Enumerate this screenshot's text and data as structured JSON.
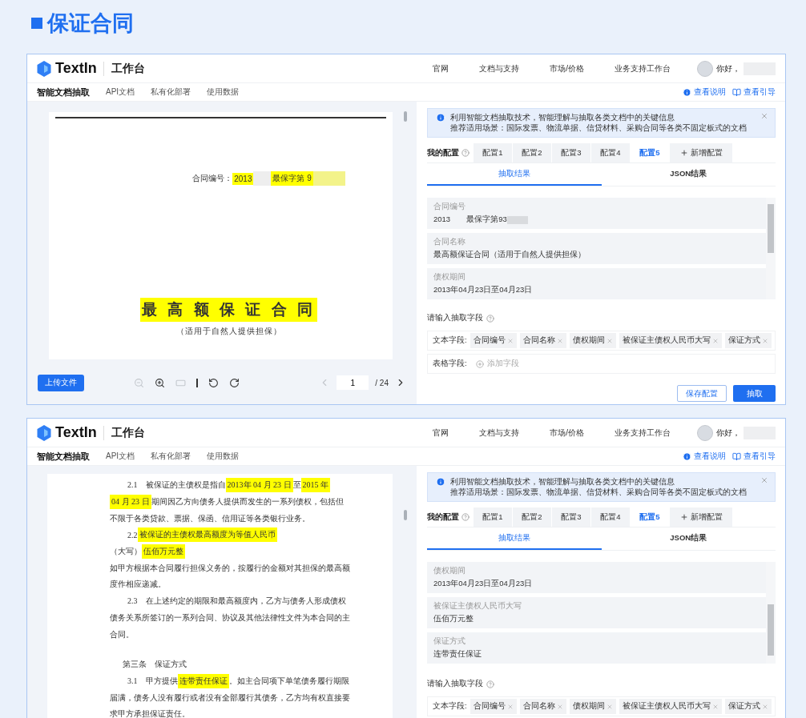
{
  "heading": "保证合同",
  "panels": [
    {
      "brand": "TextIn",
      "workspace": "工作台",
      "nav": [
        "官网",
        "文档与支持",
        "市场/价格",
        "业务支持工作台"
      ],
      "greeting": "你好，",
      "name_redacted": true,
      "tabs": [
        {
          "label": "智能文档抽取",
          "selected": true
        },
        {
          "label": "API文档",
          "selected": false
        },
        {
          "label": "私有化部署",
          "selected": false
        },
        {
          "label": "使用数据",
          "selected": false
        }
      ],
      "help_links": [
        {
          "kind": "info",
          "label": "查看说明"
        },
        {
          "kind": "guide",
          "label": "查看引导"
        }
      ],
      "document": {
        "kind": "cover",
        "lines": [
          {
            "kind": "meta",
            "segments": [
              {
                "kind": "text",
                "text": "合同编号：",
                "highlight": false
              },
              {
                "kind": "text",
                "text": "2013",
                "highlight": true
              },
              {
                "kind": "redaction",
                "highlight": false
              },
              {
                "kind": "text",
                "text": "最保字第 9",
                "highlight": true
              },
              {
                "kind": "redaction",
                "highlight": true
              }
            ]
          },
          {
            "kind": "title",
            "segments": [
              {
                "kind": "text",
                "text": "最 高 额 保 证 合 同",
                "highlight": true
              }
            ]
          },
          {
            "kind": "subtitle",
            "segments": [
              {
                "kind": "text",
                "text": "（适用于自然人提供担保）",
                "highlight": false
              }
            ]
          }
        ]
      },
      "toolbar": {
        "upload": "上传文件",
        "tools": [
          {
            "kind": "zoom-out",
            "disabled": true
          },
          {
            "kind": "zoom-in",
            "disabled": false
          },
          {
            "kind": "fit",
            "disabled": true
          },
          {
            "kind": "rotate-left",
            "disabled": false
          },
          {
            "kind": "rotate-right",
            "disabled": false
          }
        ],
        "prev_disabled": true,
        "page": "1",
        "total": "/ 24"
      },
      "banner": [
        "利用智能文档抽取技术，智能理解与抽取各类文档中的关键信息",
        "推荐适用场景：国际发票、物流单据、信贷材料、采购合同等各类不固定板式的文档"
      ],
      "config_label": "我的配置",
      "configs": [
        {
          "label": "配置1",
          "selected": false
        },
        {
          "label": "配置2",
          "selected": false
        },
        {
          "label": "配置3",
          "selected": false
        },
        {
          "label": "配置4",
          "selected": false
        },
        {
          "label": "配置5",
          "selected": true
        }
      ],
      "add_config": "新增配置",
      "result_tabs": [
        {
          "label": "抽取结果",
          "selected": true
        },
        {
          "label": "JSON结果",
          "selected": false
        }
      ],
      "results": [
        {
          "label": "合同编号",
          "value": "2013　　最保字第93",
          "redacted": true
        },
        {
          "label": "合同名称",
          "value": "最高额保证合同（适用于自然人提供担保）",
          "redacted": false
        },
        {
          "label": "债权期间",
          "value": "2013年04月23日至04月23日",
          "redacted": false
        }
      ],
      "field_prompt": "请输入抽取字段",
      "text_fields": {
        "label": "文本字段:",
        "tags": [
          "合同编号",
          "合同名称",
          "债权期间",
          "被保证主债权人民币大写",
          "保证方式"
        ]
      },
      "table_fields": {
        "label": "表格字段:",
        "placeholder": "添加字段"
      },
      "actions": [
        {
          "kind": "secondary",
          "label": "保存配置"
        },
        {
          "kind": "primary",
          "label": "抽取"
        }
      ]
    },
    {
      "brand": "TextIn",
      "workspace": "工作台",
      "nav": [
        "官网",
        "文档与支持",
        "市场/价格",
        "业务支持工作台"
      ],
      "greeting": "你好，",
      "name_redacted": true,
      "tabs": [
        {
          "label": "智能文档抽取",
          "selected": true
        },
        {
          "label": "API文档",
          "selected": false
        },
        {
          "label": "私有化部署",
          "selected": false
        },
        {
          "label": "使用数据",
          "selected": false
        }
      ],
      "help_links": [
        {
          "kind": "info",
          "label": "查看说明"
        },
        {
          "kind": "guide",
          "label": "查看引导"
        }
      ],
      "document": {
        "kind": "body",
        "lines": [
          {
            "kind": "para",
            "segments": [
              {
                "kind": "text",
                "text": "2.1　被保证的主债权是指自",
                "highlight": false
              },
              {
                "kind": "text",
                "text": "2013年 04 月 23 日",
                "highlight": true
              },
              {
                "kind": "text",
                "text": "至",
                "highlight": false
              },
              {
                "kind": "text",
                "text": "2015 年",
                "highlight": true
              }
            ]
          },
          {
            "kind": "text",
            "segments": [
              {
                "kind": "text",
                "text": "04 月 23 日",
                "highlight": true
              },
              {
                "kind": "text",
                "text": "期间因乙方向债务人提供而发生的一系列债权，包括但",
                "highlight": false
              }
            ]
          },
          {
            "kind": "text",
            "segments": [
              {
                "kind": "text",
                "text": "不限于各类贷款、票据、保函、信用证等各类银行业务。",
                "highlight": false
              }
            ]
          },
          {
            "kind": "para",
            "segments": [
              {
                "kind": "text",
                "text": "2.2 ",
                "highlight": false
              },
              {
                "kind": "text",
                "text": "被保证的主债权最高额度为等值人民币",
                "highlight": true
              }
            ]
          },
          {
            "kind": "text",
            "segments": [
              {
                "kind": "text",
                "text": "（大写）",
                "highlight": false
              },
              {
                "kind": "text",
                "text": "伍佰万元整",
                "highlight": true
              }
            ]
          },
          {
            "kind": "text",
            "segments": [
              {
                "kind": "text",
                "text": "如甲方根据本合同履行担保义务的，按履行的金额对其担保的最高额",
                "highlight": false
              }
            ]
          },
          {
            "kind": "text",
            "segments": [
              {
                "kind": "text",
                "text": "度作相应递减。",
                "highlight": false
              }
            ]
          },
          {
            "kind": "para",
            "segments": [
              {
                "kind": "text",
                "text": "2.3　在上述约定的期限和最高额度内，乙方与债务人形成债权",
                "highlight": false
              }
            ]
          },
          {
            "kind": "text",
            "segments": [
              {
                "kind": "text",
                "text": "债务关系所签订的一系列合同、协议及其他法律性文件为本合同的主",
                "highlight": false
              }
            ]
          },
          {
            "kind": "text",
            "segments": [
              {
                "kind": "text",
                "text": "合同。",
                "highlight": false
              }
            ]
          },
          {
            "kind": "heading",
            "segments": [
              {
                "kind": "text",
                "text": "第三条　保证方式",
                "highlight": false
              }
            ]
          },
          {
            "kind": "para",
            "segments": [
              {
                "kind": "text",
                "text": "3.1　甲方提供",
                "highlight": false
              },
              {
                "kind": "text",
                "text": "连带责任保证",
                "highlight": true
              },
              {
                "kind": "text",
                "text": "。如主合同项下单笔债务履行期限",
                "highlight": false
              }
            ]
          },
          {
            "kind": "text",
            "segments": [
              {
                "kind": "text",
                "text": "届满，债务人没有履行或者没有全部履行其债务，乙方均有权直接要",
                "highlight": false
              }
            ]
          },
          {
            "kind": "text",
            "segments": [
              {
                "kind": "text",
                "text": "求甲方承担保证责任。",
                "highlight": false
              }
            ]
          }
        ]
      },
      "banner": [
        "利用智能文档抽取技术，智能理解与抽取各类文档中的关键信息",
        "推荐适用场景：国际发票、物流单据、信贷材料、采购合同等各类不固定板式的文档"
      ],
      "config_label": "我的配置",
      "configs": [
        {
          "label": "配置1",
          "selected": false
        },
        {
          "label": "配置2",
          "selected": false
        },
        {
          "label": "配置3",
          "selected": false
        },
        {
          "label": "配置4",
          "selected": false
        },
        {
          "label": "配置5",
          "selected": true
        }
      ],
      "add_config": "新增配置",
      "result_tabs": [
        {
          "label": "抽取结果",
          "selected": true
        },
        {
          "label": "JSON结果",
          "selected": false
        }
      ],
      "results": [
        {
          "label": "债权期间",
          "value": "2013年04月23日至04月23日",
          "redacted": false
        },
        {
          "label": "被保证主债权人民币大写",
          "value": "伍佰万元整",
          "redacted": false
        },
        {
          "label": "保证方式",
          "value": "连带责任保证",
          "redacted": false
        }
      ],
      "field_prompt": "请输入抽取字段",
      "text_fields": {
        "label": "文本字段:",
        "tags": [
          "合同编号",
          "合同名称",
          "债权期间",
          "被保证主债权人民币大写",
          "保证方式"
        ]
      }
    }
  ]
}
